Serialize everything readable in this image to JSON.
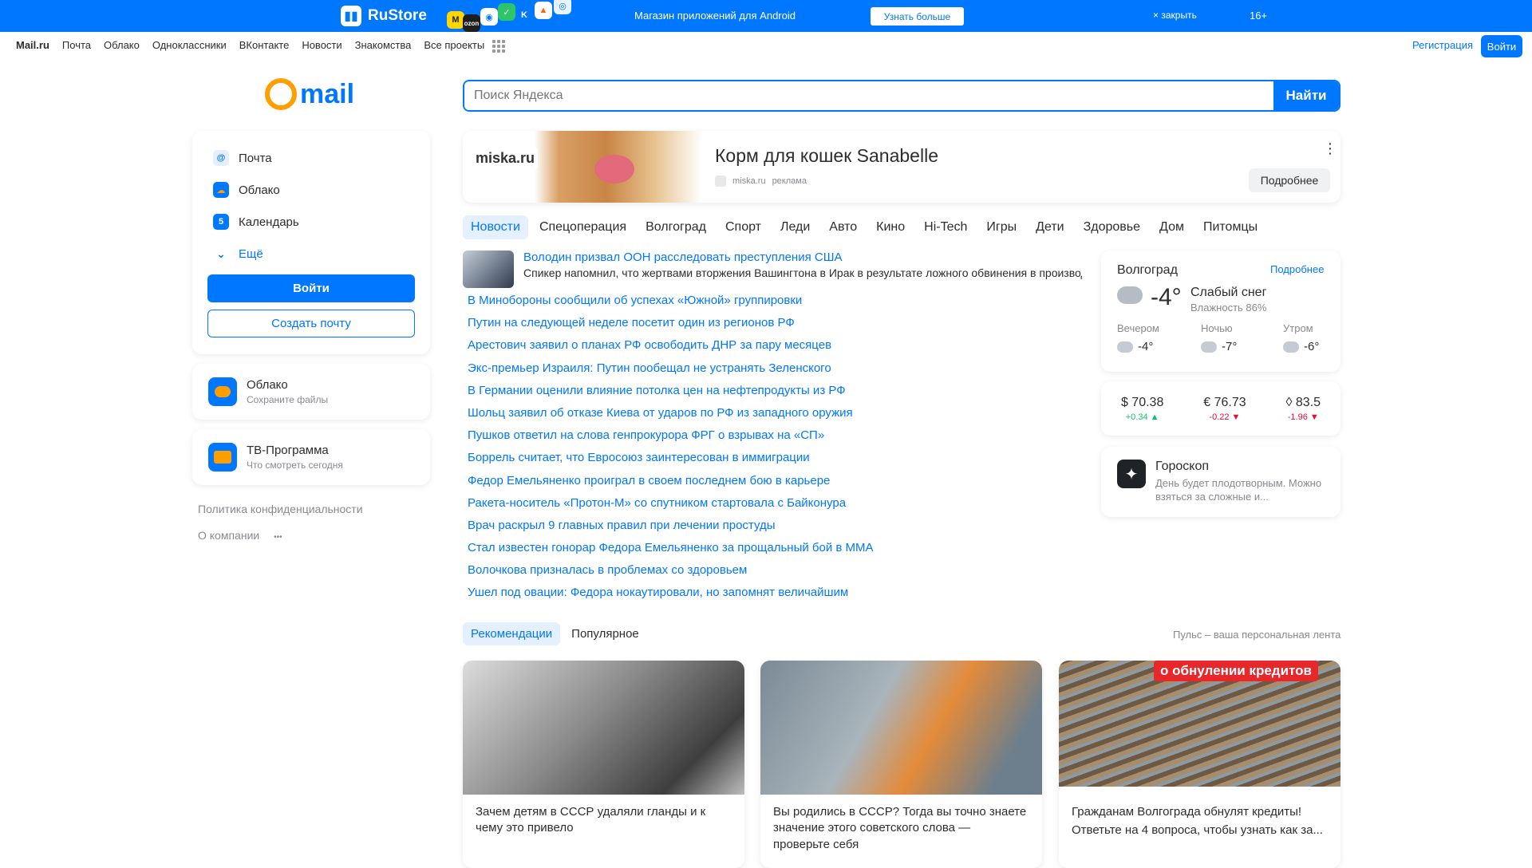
{
  "banner": {
    "brand": "RuStore",
    "promo": "Магазин приложений для Android",
    "more": "Узнать больше",
    "close": "× закрыть",
    "age": "16+",
    "colors": {
      "bg": "#0077ff"
    }
  },
  "portal": {
    "brand": "Mail.ru",
    "links": [
      "Почта",
      "Облако",
      "Одноклассники",
      "ВКонтакте",
      "Новости",
      "Знакомства",
      "Все проекты"
    ],
    "register": "Регистрация",
    "login": "Войти"
  },
  "logo": {
    "text": "mail"
  },
  "search": {
    "placeholder": "Поиск Яндекса",
    "button": "Найти"
  },
  "services": [
    {
      "label": "Почта",
      "icon": "mail-icon"
    },
    {
      "label": "Облако",
      "icon": "cloud-icon"
    },
    {
      "label": "Календарь",
      "icon": "calendar-icon"
    },
    {
      "label": "Ещё",
      "icon": "chevron-down-icon"
    }
  ],
  "auth": {
    "login": "Войти",
    "create": "Создать почту"
  },
  "cloud_card": {
    "title": "Облако",
    "subtitle": "Сохраните файлы"
  },
  "tv_card": {
    "title": "ТВ-Программа",
    "subtitle": "Что смотреть сегодня"
  },
  "side_links": {
    "privacy": "Политика конфиденциальности",
    "about": "О компании",
    "dots": "•••"
  },
  "ad": {
    "brand": "miska.ru",
    "title": "Корм для кошек Sanabelle",
    "source": "miska.ru",
    "label": "реклама",
    "button": "Подробнее"
  },
  "news_tabs": [
    "Новости",
    "Спецоперация",
    "Волгоград",
    "Спорт",
    "Леди",
    "Авто",
    "Кино",
    "Hi-Tech",
    "Игры",
    "Дети",
    "Здоровье",
    "Дом",
    "Питомцы"
  ],
  "news_top": {
    "title": "Володин призвал ООН расследовать преступления США",
    "subtitle": "Спикер напомнил, что жертвами вторжения Вашингтона в Ирак в результате ложного обвинения в производстве"
  },
  "news": [
    "В Минобороны сообщили об успехах «Южной» группировки",
    "Путин на следующей неделе посетит один из регионов РФ",
    "Арестович заявил о планах РФ освободить ДНР за пару месяцев",
    "Экс-премьер Израиля: Путин пообещал не устранять Зеленского",
    "В Германии оценили влияние потолка цен на нефтепродукты из РФ",
    "Шольц заявил об отказе Киева от ударов по РФ из западного оружия",
    "Пушков ответил на слова генпрокурора ФРГ о взрывах на «СП»",
    "Боррель считает, что Евросоюз заинтересован в иммиграции",
    "Федор Емельяненко проиграл в своем последнем бою в карьере",
    "Ракета-носитель «Протон-М» со спутником стартовала с Байконура",
    "Врач раскрыл 9 главных правил при лечении простуды",
    "Стал известен гонорар Федора Емельяненко за прощальный бой в ММА",
    "Волочкова призналась в проблемах со здоровьем",
    "Ушел под овации: Федора нокаутировали, но запомнят величайшим"
  ],
  "weather": {
    "city": "Волгоград",
    "link": "Подробнее",
    "temp": "-4°",
    "condition": "Слабый снег",
    "humidity": "Влажность 86%",
    "periods": [
      {
        "label": "Вечером",
        "temp": "-4°"
      },
      {
        "label": "Ночью",
        "temp": "-7°"
      },
      {
        "label": "Утром",
        "temp": "-6°"
      }
    ]
  },
  "currency": [
    {
      "symbol": "$",
      "value": "70.38",
      "delta": "+0.34 ▲",
      "dir": "up"
    },
    {
      "symbol": "€",
      "value": "76.73",
      "delta": "-0.22 ▼",
      "dir": "down"
    },
    {
      "symbol": "🛢",
      "value": "83.5",
      "delta": "-1.96 ▼",
      "dir": "down"
    }
  ],
  "horoscope": {
    "title": "Гороскоп",
    "text": "День будет плодотворным. Можно взяться за сложные и..."
  },
  "feed": {
    "tabs": [
      "Рекомендации",
      "Популярное"
    ],
    "note": "Пульс – ваша персональная лента",
    "cards": [
      {
        "title": "Зачем детям в СССР удаляли гланды и к чему это привело",
        "subtitle": ""
      },
      {
        "title": "Вы родились в СССР? Тогда вы точно знаете значение этого советского слова — проверьте себя",
        "subtitle": ""
      },
      {
        "title": "Гражданам Волгограда обнулят кредиты!",
        "subtitle": "Ответьте на 4 вопроса, чтобы узнать как за...",
        "badge": "о обнулении кредитов"
      }
    ]
  }
}
